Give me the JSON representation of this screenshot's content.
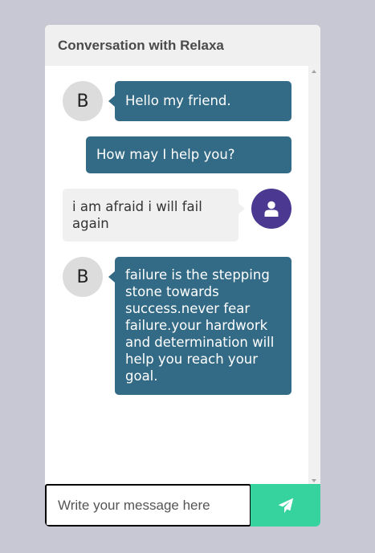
{
  "header": {
    "title": "Conversation with Relaxa"
  },
  "messages": [
    {
      "sender": "bot",
      "avatar_letter": "B",
      "text": "Hello my friend."
    },
    {
      "sender": "bot",
      "text": "How may I help you?"
    },
    {
      "sender": "user",
      "avatar_icon": "user-icon",
      "text": "i am afraid i will fail again"
    },
    {
      "sender": "bot",
      "avatar_letter": "B",
      "text": "failure is the stepping stone towards success.never fear failure.your hardwork and determination will help you reach your goal."
    }
  ],
  "composer": {
    "placeholder": "Write your message here",
    "send_icon": "paper-plane-icon"
  },
  "colors": {
    "background": "#c8c8d4",
    "bot_bubble": "#336a85",
    "user_bubble": "#f0f0f0",
    "user_avatar": "#4b3991",
    "send_button": "#36d39e"
  }
}
